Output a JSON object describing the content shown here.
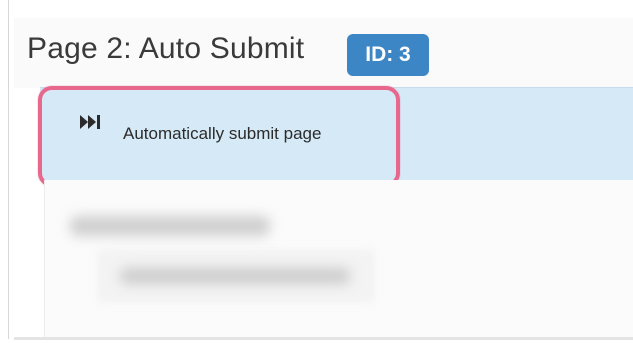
{
  "page": {
    "title": "Page 2: Auto Submit",
    "id_badge": "ID: 3"
  },
  "action": {
    "icon": "skip-forward-icon",
    "label": "Automatically submit page"
  },
  "colors": {
    "badge": "#3d86c6",
    "action_bar": "#d6e9f6",
    "highlight": "#e7688c"
  }
}
